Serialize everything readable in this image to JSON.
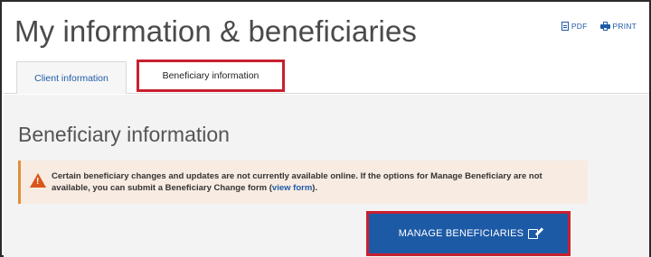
{
  "header": {
    "title": "My information & beneficiaries",
    "pdf_label": "PDF",
    "print_label": "PRINT"
  },
  "tabs": [
    {
      "label": "Client information"
    },
    {
      "label": "Beneficiary information"
    }
  ],
  "section": {
    "title": "Beneficiary information"
  },
  "alert": {
    "text": "Certain beneficiary changes and updates are not currently available online. If the options for Manage Beneficiary are not available, you can submit a Beneficiary Change form",
    "link_label": "view form"
  },
  "actions": {
    "manage_label": "MANAGE BENEFICIARIES"
  },
  "colors": {
    "accent": "#1d5aa6",
    "highlight": "#c8202f",
    "warning": "#d9571d"
  }
}
